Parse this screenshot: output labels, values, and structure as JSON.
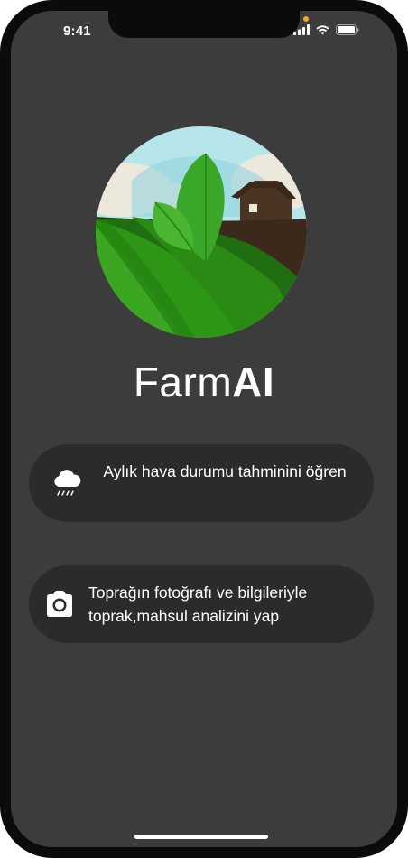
{
  "status_bar": {
    "time": "9:41"
  },
  "app": {
    "title_light": "Farm",
    "title_bold": "AI"
  },
  "actions": [
    {
      "label": "Aylık hava durumu tahminini öğren",
      "icon": "cloud-rain-icon"
    },
    {
      "label": "Toprağın fotoğrafı ve bilgileriyle toprak,mahsul analizini yap",
      "icon": "camera-icon"
    }
  ],
  "colors": {
    "background": "#3c3c3c",
    "card": "#2b2b2b",
    "text": "#ffffff",
    "leaf_green": "#3aa62a",
    "field_green": "#2b8f16",
    "barn_brown": "#4a3424",
    "sky": "#b9e6ec"
  }
}
